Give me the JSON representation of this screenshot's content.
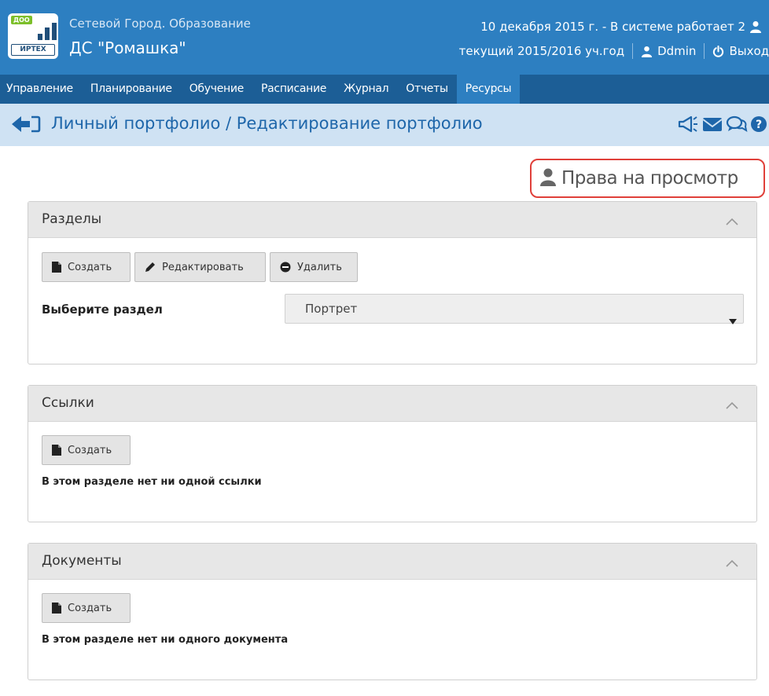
{
  "header": {
    "logo_tag": "ДОО",
    "logo_brand": "ИРТЕХ",
    "system_name": "Сетевой Город. Образование",
    "school_name": "ДС \"Ромашка\"",
    "date_status": "10 декабря 2015 г. - В системе работает 2",
    "school_year": "текущий 2015/2016 уч.год",
    "user_name": "Ddmin",
    "logout_label": "Выход"
  },
  "nav": {
    "items": [
      {
        "label": "Управление"
      },
      {
        "label": "Планирование"
      },
      {
        "label": "Обучение"
      },
      {
        "label": "Расписание"
      },
      {
        "label": "Журнал"
      },
      {
        "label": "Отчеты"
      },
      {
        "label": "Ресурсы"
      }
    ],
    "active_index": 6
  },
  "page": {
    "title": "Личный портфолио / Редактирование портфолио",
    "title_icons": [
      "bullhorn-icon",
      "envelope-icon",
      "comments-icon",
      "question-circle-icon"
    ]
  },
  "rights_button": {
    "label": "Права на просмотр"
  },
  "sections_panel": {
    "title": "Разделы",
    "create_label": "Создать",
    "edit_label": "Редактировать",
    "delete_label": "Удалить",
    "select_label": "Выберите раздел",
    "select_value": "Портрет"
  },
  "links_panel": {
    "title": "Ссылки",
    "create_label": "Создать",
    "empty_text": "В этом разделе нет ни одной ссылки"
  },
  "documents_panel": {
    "title": "Документы",
    "create_label": "Создать",
    "empty_text": "В этом разделе нет ни одного документа"
  },
  "colors": {
    "header_blue": "#2d7fc1",
    "nav_blue": "#1c5e96",
    "title_bar": "#cfe2f3",
    "title_text": "#1e66aa",
    "highlight_red": "#e0403a"
  }
}
